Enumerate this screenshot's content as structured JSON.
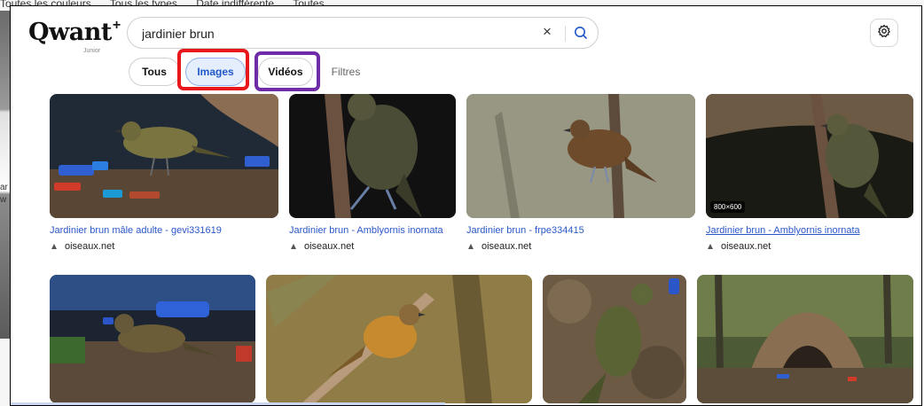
{
  "background": {
    "filters": [
      "Toutes les couleurs",
      "Tous les types",
      "Date indifférente",
      "Toutes"
    ],
    "left_text": [
      "ar",
      "w"
    ]
  },
  "logo": {
    "word": "Qwant",
    "plus": "+",
    "sub": "Junior"
  },
  "search": {
    "value": "jardinier brun",
    "clear": "×"
  },
  "tabs": {
    "tous": "Tous",
    "images": "Images",
    "videos": "Vidéos",
    "filtres": "Filtres"
  },
  "results": [
    {
      "title": "Jardinier brun mâle adulte - gevi331619",
      "source": "oiseaux.net"
    },
    {
      "title": "Jardinier brun - Amblyornis inornata",
      "source": "oiseaux.net"
    },
    {
      "title": "Jardinier brun - frpe334415",
      "source": "oiseaux.net"
    },
    {
      "title": "Jardinier brun - Amblyornis inornata",
      "source": "oiseaux.net",
      "badge": "800×600"
    }
  ],
  "second_row_count": 4,
  "colors": {
    "accent": "#2058c9",
    "link": "#2a57c8",
    "highlight_red": "#e8171c",
    "highlight_purple": "#6e2ca8"
  }
}
